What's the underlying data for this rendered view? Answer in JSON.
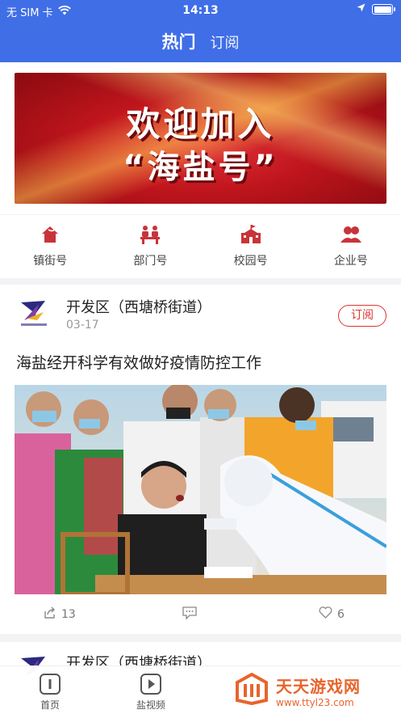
{
  "status": {
    "carrier": "无 SIM 卡",
    "time": "14:13"
  },
  "header": {
    "tabs": [
      {
        "label": "热门",
        "active": true
      },
      {
        "label": "订阅",
        "active": false
      }
    ]
  },
  "banner": {
    "line1": "欢迎加入",
    "line2": "“海盐号”"
  },
  "categories": [
    {
      "label": "镇街号",
      "icon": "house-icon"
    },
    {
      "label": "部门号",
      "icon": "office-desk-icon"
    },
    {
      "label": "校园号",
      "icon": "school-icon"
    },
    {
      "label": "企业号",
      "icon": "people-icon"
    }
  ],
  "feed": [
    {
      "source": "开发区（西塘桥街道）",
      "date": "03-17",
      "subscribe_label": "订阅",
      "headline": "海盐经开科学有效做好疫情防控工作",
      "share_count": "13",
      "like_count": "6"
    },
    {
      "source": "开发区（西塘桥街道）"
    }
  ],
  "bottom_nav": {
    "home_label": "首页",
    "video_label": "盐视频"
  },
  "watermark": {
    "title": "天天游戏网",
    "url": "www.ttyl23.com"
  },
  "colors": {
    "header": "#3f6ee7",
    "accent": "#d9362f",
    "icon": "#c8343a"
  }
}
